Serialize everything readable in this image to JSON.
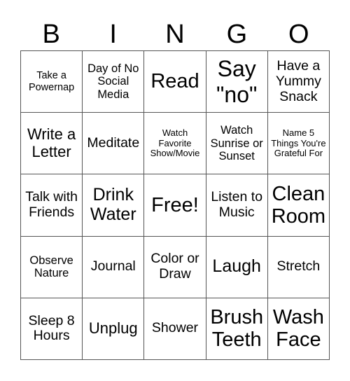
{
  "title_letters": [
    "B",
    "I",
    "N",
    "G",
    "O"
  ],
  "cells": [
    [
      "Take a Powernap",
      "Day of No Social Media",
      "Read",
      "Say \"no\"",
      "Have a Yummy Snack"
    ],
    [
      "Write a Letter",
      "Meditate",
      "Watch Favorite Show/Movie",
      "Watch Sunrise or Sunset",
      "Name 5 Things You're Grateful For"
    ],
    [
      "Talk with Friends",
      "Drink Water",
      "Free!",
      "Listen to Music",
      "Clean Room"
    ],
    [
      "Observe Nature",
      "Journal",
      "Color or Draw",
      "Laugh",
      "Stretch"
    ],
    [
      "Sleep 8 Hours",
      "Unplug",
      "Shower",
      "Brush Teeth",
      "Wash Face"
    ]
  ]
}
